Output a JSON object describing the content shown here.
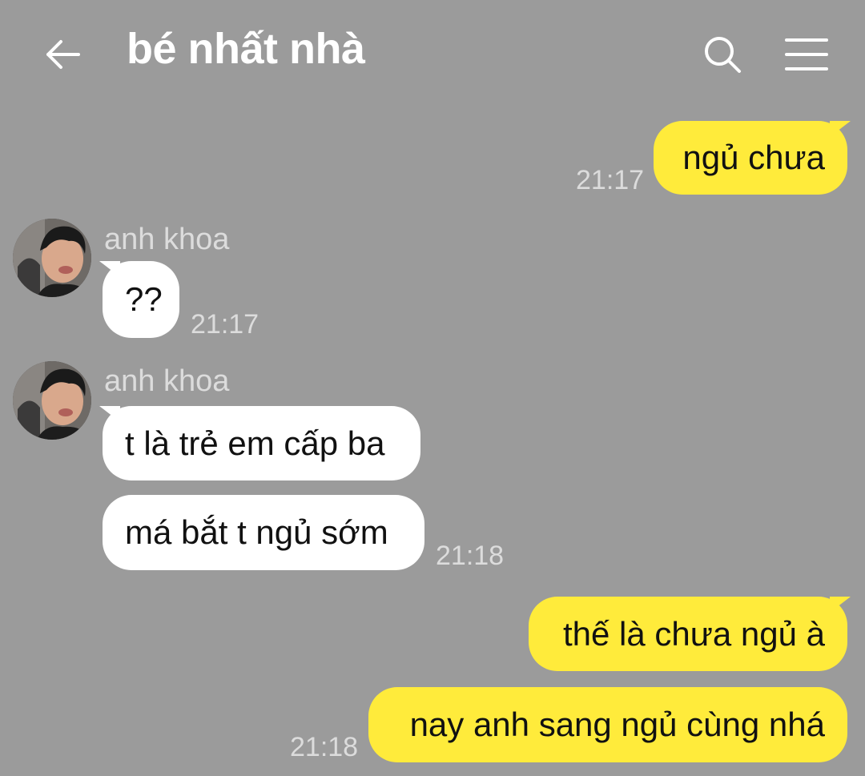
{
  "header": {
    "title": "bé nhất nhà",
    "back_icon": "arrow-left-icon",
    "search_icon": "search-icon",
    "menu_icon": "hamburger-menu-icon"
  },
  "colors": {
    "background": "#9b9b9b",
    "outgoing_bubble": "#ffeb3b",
    "incoming_bubble": "#ffffff",
    "timestamp": "#dcdcdc"
  },
  "messages": [
    {
      "direction": "outgoing",
      "text": "ngủ chưa",
      "time": "21:17"
    },
    {
      "direction": "incoming",
      "sender": "anh khoa",
      "text": "??",
      "time": "21:17"
    },
    {
      "direction": "incoming",
      "sender": "anh khoa",
      "text": "t là trẻ em cấp ba",
      "time": ""
    },
    {
      "direction": "incoming",
      "sender": "",
      "text": "má bắt t ngủ sớm",
      "time": "21:18"
    },
    {
      "direction": "outgoing",
      "text": "thế là chưa ngủ à",
      "time": ""
    },
    {
      "direction": "outgoing",
      "text": "nay anh sang ngủ cùng nhá",
      "time": "21:18"
    }
  ]
}
